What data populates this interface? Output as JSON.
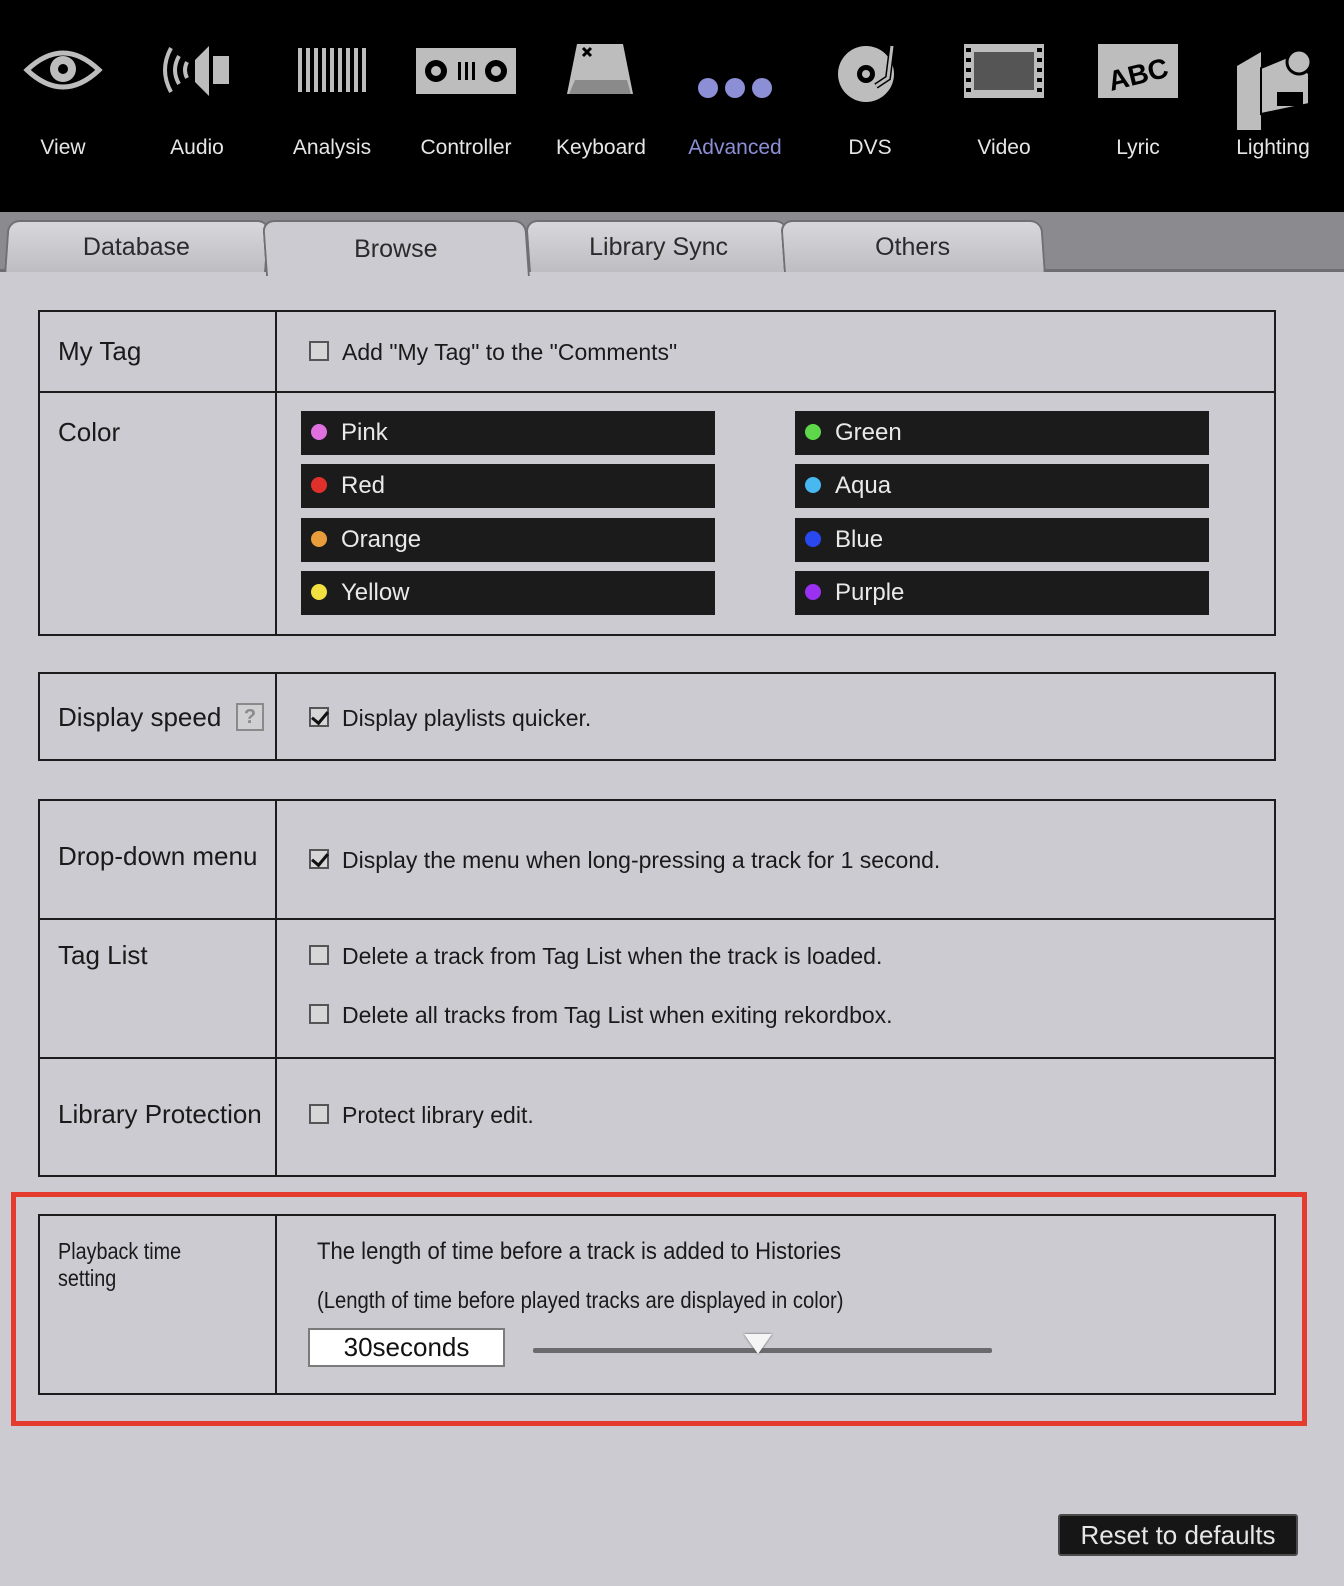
{
  "toolbar": {
    "items": [
      {
        "label": "View",
        "icon": "eye-icon"
      },
      {
        "label": "Audio",
        "icon": "speaker-icon"
      },
      {
        "label": "Analysis",
        "icon": "analysis-bars-icon"
      },
      {
        "label": "Controller",
        "icon": "controller-icon"
      },
      {
        "label": "Keyboard",
        "icon": "keyboard-key-icon"
      },
      {
        "label": "Advanced",
        "icon": "three-dots-icon",
        "active": true
      },
      {
        "label": "DVS",
        "icon": "turntable-icon"
      },
      {
        "label": "Video",
        "icon": "film-icon"
      },
      {
        "label": "Lyric",
        "icon": "abc-lyric-icon"
      },
      {
        "label": "Lighting",
        "icon": "moving-head-light-icon"
      }
    ],
    "active_color": "#8c8fd6"
  },
  "tabs": [
    {
      "label": "Database"
    },
    {
      "label": "Browse",
      "active": true
    },
    {
      "label": "Library Sync"
    },
    {
      "label": "Others"
    }
  ],
  "my_tag": {
    "label": "My Tag",
    "option": "Add \"My Tag\" to the \"Comments\"",
    "checked": false
  },
  "color": {
    "label": "Color",
    "items": [
      {
        "name": "Pink",
        "hex": "#e070e0"
      },
      {
        "name": "Red",
        "hex": "#e0302b"
      },
      {
        "name": "Orange",
        "hex": "#e89c3c"
      },
      {
        "name": "Yellow",
        "hex": "#f0e040"
      },
      {
        "name": "Green",
        "hex": "#5ed84a"
      },
      {
        "name": "Aqua",
        "hex": "#48b8f0"
      },
      {
        "name": "Blue",
        "hex": "#2a48f0"
      },
      {
        "name": "Purple",
        "hex": "#9a30f0"
      }
    ]
  },
  "display_speed": {
    "label": "Display speed",
    "help": "?",
    "option": "Display playlists quicker.",
    "checked": true
  },
  "dropdown_menu": {
    "label": "Drop-down menu",
    "option": "Display the menu when long-pressing a track for 1 second.",
    "checked": true
  },
  "tag_list": {
    "label": "Tag List",
    "options": [
      {
        "text": "Delete a track from Tag List when the track is loaded.",
        "checked": false
      },
      {
        "text": "Delete all tracks from Tag List when exiting rekordbox.",
        "checked": false
      }
    ]
  },
  "library_protection": {
    "label": "Library Protection",
    "option": "Protect library edit.",
    "checked": false
  },
  "playback_time": {
    "label": "Playback time setting",
    "line1": "The length of time before a track is added to Histories",
    "line2": "(Length of time before played tracks are displayed in color)",
    "value": "30seconds",
    "slider_fraction": 0.49
  },
  "reset_button": "Reset to defaults",
  "highlight_color": "#e43d2f"
}
